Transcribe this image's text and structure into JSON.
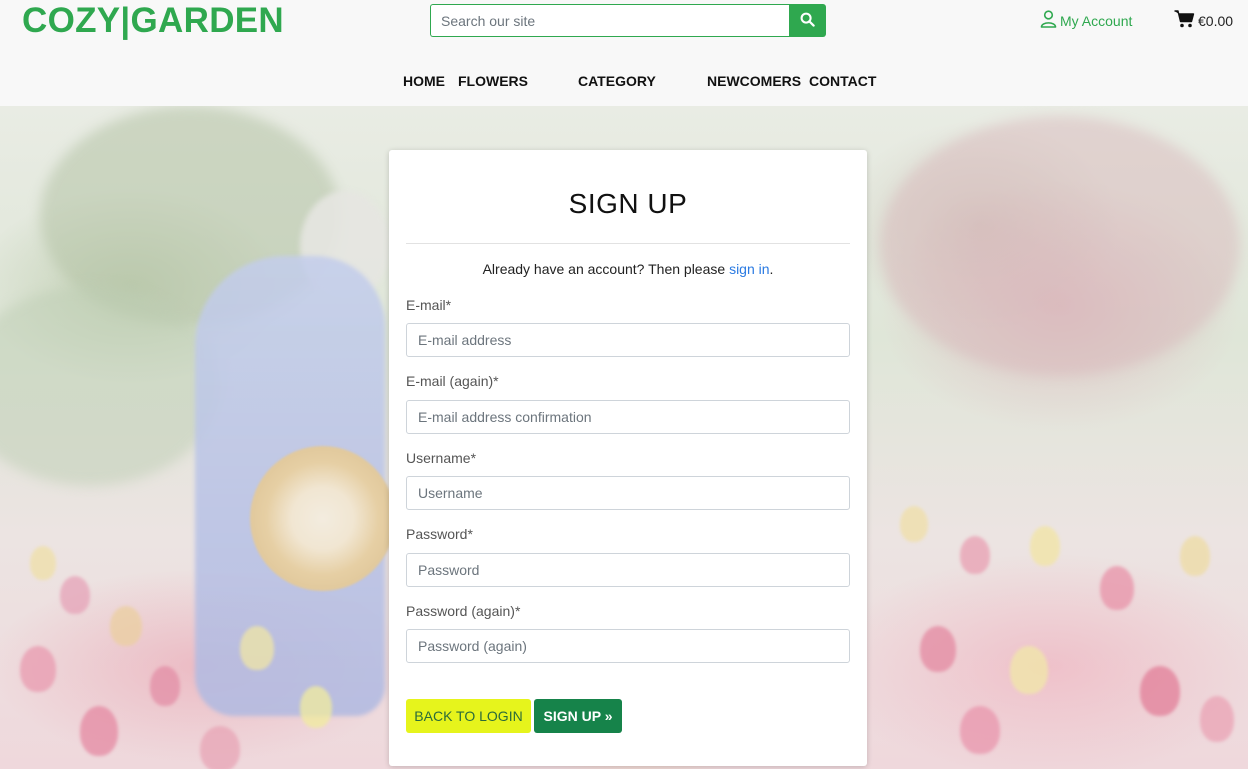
{
  "header": {
    "logo": "COZY|GARDEN",
    "search_placeholder": "Search our site",
    "account_label": "My Account",
    "cart_total": "€0.00"
  },
  "nav": {
    "items": [
      "HOME",
      "FLOWERS",
      "CATEGORY",
      "NEWCOMERS",
      "CONTACT"
    ]
  },
  "form": {
    "title": "SIGN UP",
    "already_text": "Already have an account? Then please ",
    "signin_link": "sign in",
    "already_suffix": ".",
    "fields": [
      {
        "label": "E-mail*",
        "placeholder": "E-mail address"
      },
      {
        "label": "E-mail (again)*",
        "placeholder": "E-mail address confirmation"
      },
      {
        "label": "Username*",
        "placeholder": "Username"
      },
      {
        "label": "Password*",
        "placeholder": "Password"
      },
      {
        "label": "Password (again)*",
        "placeholder": "Password (again)"
      }
    ],
    "back_button": "BACK TO LOGIN",
    "signup_button": "SIGN UP »"
  },
  "colors": {
    "brand_green": "#2fa84f",
    "signup_button": "#16834a",
    "back_button": "#e6f41c",
    "link": "#2a7ae2"
  },
  "icons": {
    "search": "search-icon",
    "account": "user-icon",
    "cart": "cart-icon"
  }
}
